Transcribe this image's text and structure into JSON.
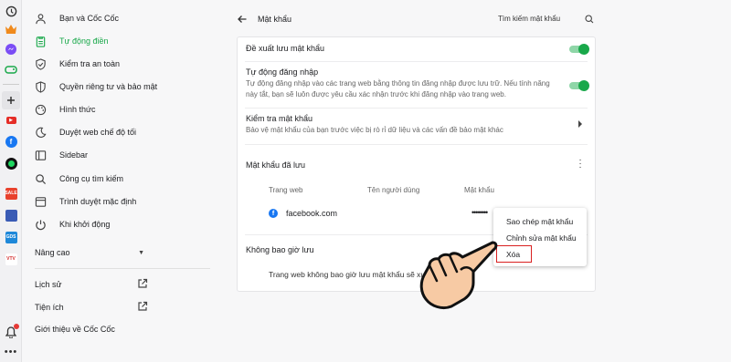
{
  "rail": {
    "items": [
      "history-icon",
      "crown-icon",
      "messenger-icon",
      "game-icon",
      "plus-icon",
      "youtube-icon",
      "facebook-icon",
      "spotify-icon",
      "shop-icon",
      "game-app-icon",
      "news-icon",
      "vtv-icon"
    ],
    "badge_sale": "SALE",
    "badge_gds": "GDS",
    "badge_vtv": "VTV"
  },
  "sidebar": {
    "items": [
      {
        "label": "Bạn và Cốc Cốc",
        "icon": "person-icon"
      },
      {
        "label": "Tự động điền",
        "icon": "clipboard-icon",
        "active": true
      },
      {
        "label": "Kiểm tra an toàn",
        "icon": "shield-icon"
      },
      {
        "label": "Quyền riêng tư và bảo mật",
        "icon": "privacy-shield-icon"
      },
      {
        "label": "Hình thức",
        "icon": "palette-icon"
      },
      {
        "label": "Duyệt web chế độ tối",
        "icon": "moon-icon"
      },
      {
        "label": "Sidebar",
        "icon": "sidebar-icon"
      },
      {
        "label": "Công cụ tìm kiếm",
        "icon": "search-icon"
      },
      {
        "label": "Trình duyệt mặc định",
        "icon": "browser-icon"
      },
      {
        "label": "Khi khởi động",
        "icon": "power-icon"
      }
    ],
    "advanced": "Nâng cao",
    "history": "Lịch sử",
    "extensions": "Tiện ích",
    "about": "Giới thiệu về Cốc Cốc"
  },
  "header": {
    "title": "Mật khẩu",
    "search_label": "Tìm kiếm mật khẩu"
  },
  "settings": {
    "offer_save": {
      "title": "Đề xuất lưu mật khẩu",
      "enabled": true
    },
    "auto_login": {
      "title": "Tự động đăng nhập",
      "desc_line1": "Tự động đăng nhập vào các trang web bằng thông tin đăng nhập được lưu trữ. Nếu tính năng",
      "desc_line2": "này tắt, bạn sẽ luôn được yêu cầu xác nhận trước khi đăng nhập vào trang web.",
      "enabled": true
    },
    "check": {
      "title": "Kiểm tra mật khẩu",
      "desc": "Bảo vệ mật khẩu của bạn trước việc bị rò rỉ dữ liệu và các vấn đề bảo mật khác"
    }
  },
  "saved": {
    "heading": "Mật khẩu đã lưu",
    "columns": [
      "Trang web",
      "Tên người dùng",
      "Mật khẩu"
    ],
    "rows": [
      {
        "site": "facebook.com",
        "username": "",
        "password": "••••••••"
      }
    ]
  },
  "never": {
    "heading": "Không bao giờ lưu",
    "empty": "Trang web không bao giờ lưu mật khẩu sẽ xuất"
  },
  "context_menu": {
    "items": [
      "Sao chép mật khẩu",
      "Chỉnh sửa mật khẩu",
      "Xóa"
    ],
    "highlighted": "Xóa",
    "highlight_color": "#d92020"
  },
  "colors": {
    "accent": "#19a84a"
  }
}
